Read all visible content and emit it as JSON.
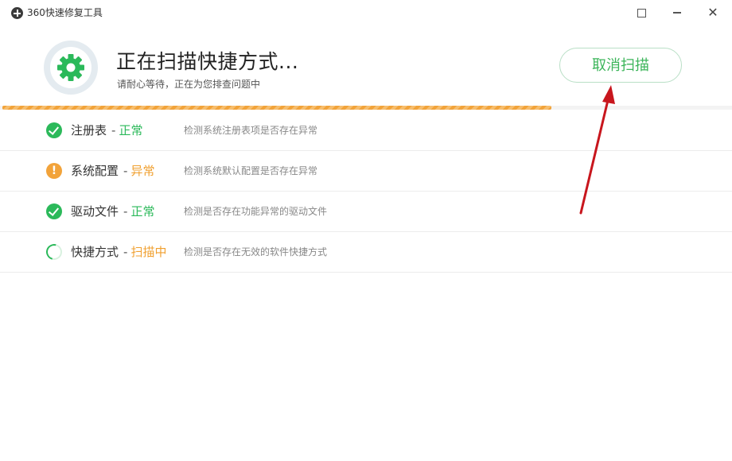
{
  "window": {
    "title": "360快速修复工具",
    "maximize_glyph": "□",
    "minimize_glyph": "—",
    "close_glyph": "✕"
  },
  "header": {
    "title": "正在扫描快捷方式...",
    "subtitle": "请耐心等待，正在为您排查问题中",
    "icon": "gear-icon",
    "cancel_label": "取消扫描"
  },
  "progress": {
    "value": 0.75
  },
  "items": [
    {
      "name": "注册表",
      "status": "正常",
      "status_kind": "ok",
      "description": "检测系统注册表项是否存在异常"
    },
    {
      "name": "系统配置",
      "status": "异常",
      "status_kind": "warn",
      "description": "检测系统默认配置是否存在异常"
    },
    {
      "name": "驱动文件",
      "status": "正常",
      "status_kind": "ok",
      "description": "检测是否存在功能异常的驱动文件"
    },
    {
      "name": "快捷方式",
      "status": "扫描中",
      "status_kind": "scanning",
      "description": "检测是否存在无效的软件快捷方式"
    }
  ],
  "colors": {
    "accent_green": "#2bb95a",
    "warn_orange": "#f2a33a",
    "arrow_red": "#c8161d"
  }
}
